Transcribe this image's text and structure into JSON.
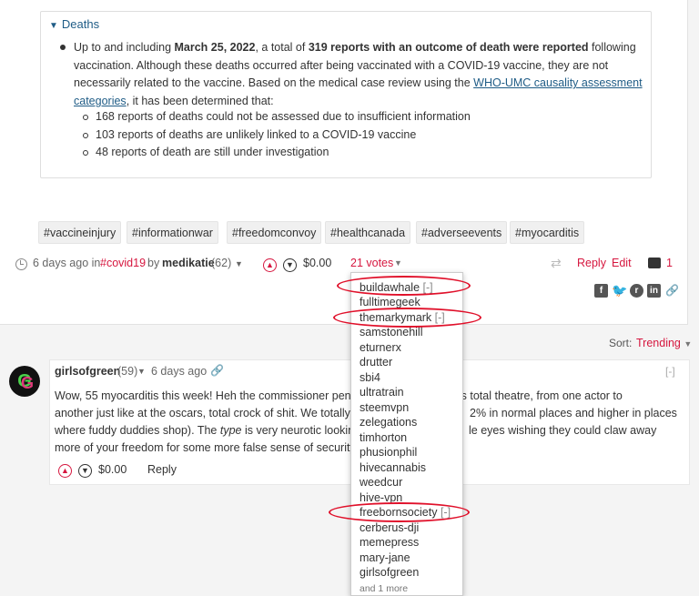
{
  "deaths": {
    "summary": "Deaths",
    "text_1": "Up to and including ",
    "date": "March 25, 2022",
    "text_2": ", a total of ",
    "bold_reports": "319 reports with an outcome of death were reported",
    "text_3": " following vaccination. Although these deaths occurred after being vaccinated with a COVID-19 vaccine, they are not necessarily related to the vaccine. Based on the medical case review using the ",
    "link": "WHO-UMC causality assessment categories",
    "text_4": ", it has been determined that:",
    "sub_items": [
      "168 reports of deaths could not be assessed due to insufficient information",
      "103 reports of deaths are unlikely linked to a COVID-19 vaccine",
      "48 reports of death are still under investigation"
    ]
  },
  "tags": [
    "#vaccineinjury",
    "#informationwar",
    "#freedomconvoy",
    "#healthcanada",
    "#adverseevents",
    "#myocarditis"
  ],
  "post_meta": {
    "time": "6 days ago in",
    "category": "#covid19",
    "by": "by",
    "author": "medikatie",
    "reputation": "(62)",
    "payout": "$0.00",
    "votes": "21 votes",
    "reply": "Reply",
    "edit": "Edit",
    "comment_count": "1"
  },
  "voters": [
    {
      "name": "buildawhale",
      "remove": "[-]"
    },
    {
      "name": "fulltimegeek",
      "remove": ""
    },
    {
      "name": "themarkymark",
      "remove": "[-]"
    },
    {
      "name": "samstonehill",
      "remove": ""
    },
    {
      "name": "eturnerx",
      "remove": ""
    },
    {
      "name": "drutter",
      "remove": ""
    },
    {
      "name": "sbi4",
      "remove": ""
    },
    {
      "name": "ultratrain",
      "remove": ""
    },
    {
      "name": "steemvpn",
      "remove": ""
    },
    {
      "name": "zelegations",
      "remove": ""
    },
    {
      "name": "timhorton",
      "remove": ""
    },
    {
      "name": "phusionphil",
      "remove": ""
    },
    {
      "name": "hivecannabis",
      "remove": ""
    },
    {
      "name": "weedcur",
      "remove": ""
    },
    {
      "name": "hive-vpn",
      "remove": ""
    },
    {
      "name": "freebornsociety",
      "remove": "[-]"
    },
    {
      "name": "cerberus-dji",
      "remove": ""
    },
    {
      "name": "memepress",
      "remove": ""
    },
    {
      "name": "mary-jane",
      "remove": ""
    },
    {
      "name": "girlsofgreen",
      "remove": ""
    }
  ],
  "voters_more": "and 1 more",
  "sort": {
    "label": "Sort:",
    "value": "Trending"
  },
  "comment": {
    "author": "girlsofgreen",
    "reputation": "(59)",
    "time": "6 days ago",
    "collapse": "[-]",
    "line1a": "Wow, 55 myocarditis this week! Heh the commissioner penni",
    "line1b": "ry is total theatre, from one actor to",
    "line2a": "another just like at the oscars, total crock of shit. We totally kn",
    "line2b": "2% in normal places and higher in places",
    "line3a": "where fuddy duddies shop). The ",
    "type_word": "type",
    "line3b": " is very neurotic looking",
    "line3c": "le eyes wishing they could claw away",
    "line4a": "more of your freedom for some more false sense of security s",
    "payout": "$0.00",
    "reply": "Reply"
  },
  "colors": {
    "accent": "#d6173f",
    "link": "#1f5c86",
    "annotation": "#e0102a"
  }
}
